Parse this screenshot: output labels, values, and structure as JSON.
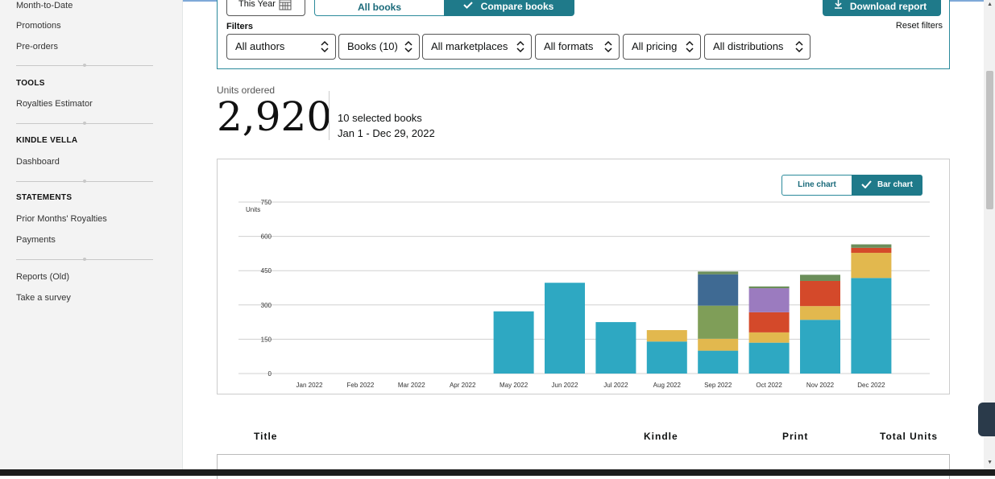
{
  "sidebar": {
    "items_top": [
      "Month-to-Date",
      "Promotions",
      "Pre-orders"
    ],
    "tools": {
      "heading": "TOOLS",
      "items": [
        "Royalties Estimator"
      ]
    },
    "kindle_vella": {
      "heading": "KINDLE VELLA",
      "items": [
        "Dashboard"
      ]
    },
    "statements": {
      "heading": "STATEMENTS",
      "items": [
        "Prior Months' Royalties",
        "Payments"
      ]
    },
    "items_bottom": [
      "Reports (Old)",
      "Take a survey"
    ]
  },
  "toolbar": {
    "date_range_label": "This Year",
    "all_books_label": "All books",
    "compare_books_label": "Compare books",
    "download_label": "Download report"
  },
  "filters": {
    "label": "Filters",
    "reset_label": "Reset filters",
    "dropdowns": [
      "All authors",
      "Books (10)",
      "All marketplaces",
      "All formats",
      "All pricing",
      "All distributions"
    ]
  },
  "summary": {
    "label": "Units ordered",
    "value": "2,920",
    "selected_books": "10 selected books",
    "date_range": "Jan 1 - Dec 29, 2022"
  },
  "chart_toggle": {
    "line_label": "Line chart",
    "bar_label": "Bar chart",
    "selected": "Bar chart"
  },
  "chart_data": {
    "type": "bar",
    "stacked": true,
    "ylabel": "Units",
    "ylim": [
      0,
      750
    ],
    "yticks": [
      0,
      150,
      300,
      450,
      600,
      750
    ],
    "grid": true,
    "categories": [
      "Jan 2022",
      "Feb 2022",
      "Mar 2022",
      "Apr 2022",
      "May 2022",
      "Jun 2022",
      "Jul 2022",
      "Aug 2022",
      "Sep 2022",
      "Oct 2022",
      "Nov 2022",
      "Dec 2022"
    ],
    "series": [
      {
        "color": "#2ea8c2",
        "values": [
          0,
          0,
          0,
          0,
          272,
          397,
          225,
          140,
          100,
          135,
          235,
          418
        ]
      },
      {
        "color": "#e2b84e",
        "values": [
          0,
          0,
          0,
          0,
          0,
          0,
          0,
          50,
          52,
          45,
          60,
          110
        ]
      },
      {
        "color": "#7f9e58",
        "values": [
          0,
          0,
          0,
          0,
          0,
          0,
          0,
          0,
          145,
          0,
          0,
          0
        ]
      },
      {
        "color": "#d4492a",
        "values": [
          0,
          0,
          0,
          0,
          0,
          0,
          0,
          0,
          0,
          88,
          110,
          22
        ]
      },
      {
        "color": "#9b7bbf",
        "values": [
          0,
          0,
          0,
          0,
          0,
          0,
          0,
          0,
          0,
          105,
          0,
          0
        ]
      },
      {
        "color": "#3f6a93",
        "values": [
          0,
          0,
          0,
          0,
          0,
          0,
          0,
          0,
          137,
          0,
          0,
          0
        ]
      },
      {
        "color": "#6b8e5a",
        "values": [
          0,
          0,
          0,
          0,
          0,
          0,
          0,
          0,
          12,
          8,
          27,
          15
        ]
      }
    ]
  },
  "table": {
    "columns": [
      "Title",
      "Kindle",
      "Print",
      "Total Units"
    ]
  }
}
